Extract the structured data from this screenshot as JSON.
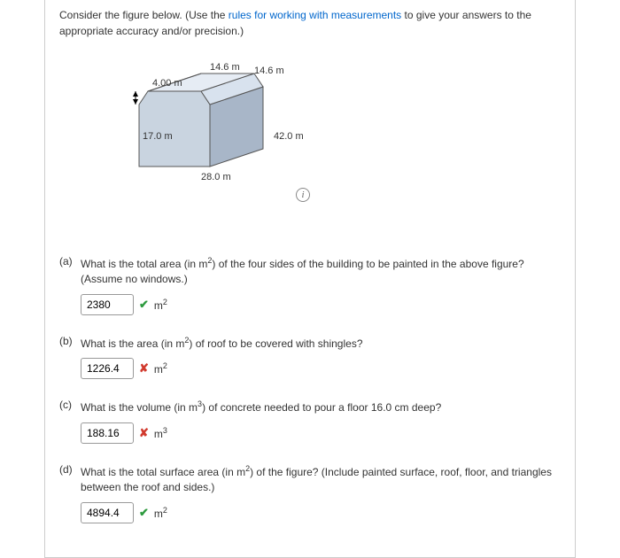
{
  "prompt": {
    "pre": "Consider the figure below. (Use the ",
    "link_text": "rules for working with measurements",
    "post": " to give your answers to the appropriate accuracy and/or precision.)"
  },
  "figure": {
    "labels": {
      "roof_left": "14.6 m",
      "roof_right": "14.6 m",
      "peak_drop": "4.00 m",
      "height": "17.0 m",
      "depth": "28.0 m",
      "width": "42.0 m"
    }
  },
  "questions": {
    "a": {
      "label": "(a)",
      "text_pre": "What is the total area (in m",
      "exp": "2",
      "text_post": ") of the four sides of the building to be painted in the above figure? (Assume no windows.)",
      "value": "2380",
      "unit_base": "m",
      "unit_exp": "2",
      "status": "correct"
    },
    "b": {
      "label": "(b)",
      "text_pre": "What is the area (in m",
      "exp": "2",
      "text_post": ") of roof to be covered with shingles?",
      "value": "1226.4",
      "unit_base": "m",
      "unit_exp": "2",
      "status": "wrong"
    },
    "c": {
      "label": "(c)",
      "text_pre": "What is the volume (in m",
      "exp": "3",
      "text_post": ") of concrete needed to pour a floor 16.0 cm deep?",
      "value": "188.16",
      "unit_base": "m",
      "unit_exp": "3",
      "status": "wrong"
    },
    "d": {
      "label": "(d)",
      "text_pre": "What is the total surface area (in m",
      "exp": "2",
      "text_post": ") of the figure? (Include painted surface, roof, floor, and triangles between the roof and sides.)",
      "value": "4894.4",
      "unit_base": "m",
      "unit_exp": "2",
      "status": "correct"
    }
  },
  "marks": {
    "correct": "✔",
    "wrong": "✘"
  }
}
